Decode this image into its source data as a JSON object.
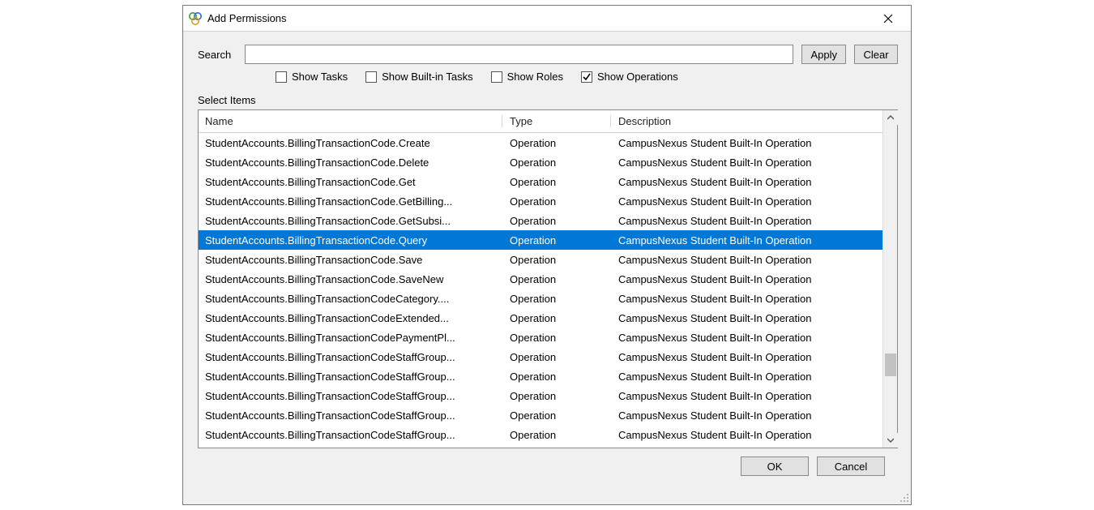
{
  "window": {
    "title": "Add Permissions"
  },
  "search": {
    "label": "Search",
    "value": "",
    "apply_label": "Apply",
    "clear_label": "Clear"
  },
  "filters": {
    "show_tasks": {
      "label": "Show Tasks",
      "checked": false
    },
    "show_builtin_tasks": {
      "label": "Show Built-in Tasks",
      "checked": false
    },
    "show_roles": {
      "label": "Show Roles",
      "checked": false
    },
    "show_operations": {
      "label": "Show Operations",
      "checked": true
    }
  },
  "grid": {
    "section_label": "Select Items",
    "columns": {
      "name": "Name",
      "type": "Type",
      "description": "Description"
    },
    "selected_index": 5,
    "rows": [
      {
        "name": "StudentAccounts.BillingTransactionCode.Create",
        "type": "Operation",
        "description": "CampusNexus Student Built-In Operation"
      },
      {
        "name": "StudentAccounts.BillingTransactionCode.Delete",
        "type": "Operation",
        "description": "CampusNexus Student Built-In Operation"
      },
      {
        "name": "StudentAccounts.BillingTransactionCode.Get",
        "type": "Operation",
        "description": "CampusNexus Student Built-In Operation"
      },
      {
        "name": "StudentAccounts.BillingTransactionCode.GetBilling...",
        "type": "Operation",
        "description": "CampusNexus Student Built-In Operation"
      },
      {
        "name": "StudentAccounts.BillingTransactionCode.GetSubsi...",
        "type": "Operation",
        "description": "CampusNexus Student Built-In Operation"
      },
      {
        "name": "StudentAccounts.BillingTransactionCode.Query",
        "type": "Operation",
        "description": "CampusNexus Student Built-In Operation"
      },
      {
        "name": "StudentAccounts.BillingTransactionCode.Save",
        "type": "Operation",
        "description": "CampusNexus Student Built-In Operation"
      },
      {
        "name": "StudentAccounts.BillingTransactionCode.SaveNew",
        "type": "Operation",
        "description": "CampusNexus Student Built-In Operation"
      },
      {
        "name": "StudentAccounts.BillingTransactionCodeCategory....",
        "type": "Operation",
        "description": "CampusNexus Student Built-In Operation"
      },
      {
        "name": "StudentAccounts.BillingTransactionCodeExtended...",
        "type": "Operation",
        "description": "CampusNexus Student Built-In Operation"
      },
      {
        "name": "StudentAccounts.BillingTransactionCodePaymentPl...",
        "type": "Operation",
        "description": "CampusNexus Student Built-In Operation"
      },
      {
        "name": "StudentAccounts.BillingTransactionCodeStaffGroup...",
        "type": "Operation",
        "description": "CampusNexus Student Built-In Operation"
      },
      {
        "name": "StudentAccounts.BillingTransactionCodeStaffGroup...",
        "type": "Operation",
        "description": "CampusNexus Student Built-In Operation"
      },
      {
        "name": "StudentAccounts.BillingTransactionCodeStaffGroup...",
        "type": "Operation",
        "description": "CampusNexus Student Built-In Operation"
      },
      {
        "name": "StudentAccounts.BillingTransactionCodeStaffGroup...",
        "type": "Operation",
        "description": "CampusNexus Student Built-In Operation"
      },
      {
        "name": "StudentAccounts.BillingTransactionCodeStaffGroup...",
        "type": "Operation",
        "description": "CampusNexus Student Built-In Operation"
      }
    ]
  },
  "footer": {
    "ok_label": "OK",
    "cancel_label": "Cancel"
  }
}
